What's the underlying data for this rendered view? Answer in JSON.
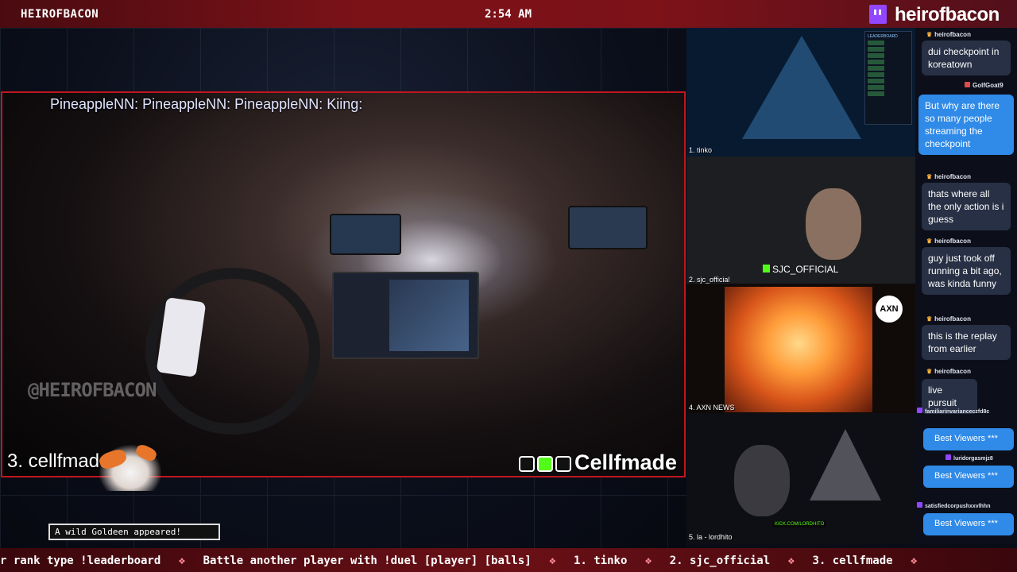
{
  "top_bar": {
    "channel_label": "HEIROFBACON",
    "clock": "2:54 AM",
    "platform_icon": "twitch-icon",
    "streamer_name": "heirofbacon"
  },
  "main_cam": {
    "overlay_ticker": "PineappleNN:  PineappleNN:  PineappleNN:  Kiing:",
    "watermark": "@HEIROFBACON",
    "rank_label": "3. cellfmade",
    "social_handle": "Cellfmade",
    "social_icons": [
      "instagram-icon",
      "kick-icon",
      "x-icon"
    ]
  },
  "pokemon_toast": "A wild Goldeen appeared!",
  "side_panels": [
    {
      "label": "1. tinko"
    },
    {
      "label": "2. sjc_official",
      "overlay": "SJC_OFFICIAL"
    },
    {
      "label": "4. AXN NEWS",
      "logo": "AXN"
    },
    {
      "label": "5. la - lordhito",
      "overlay": "KICK.COM/LORDHITO"
    }
  ],
  "leaderboard": {
    "title": "LEADERBOARD"
  },
  "chat": [
    {
      "user": "heirofbacon",
      "text": "dui checkpoint in koreatown",
      "style": "dark"
    },
    {
      "user": "GolfGoat9",
      "text": "But why are there so many people streaming the checkpoint",
      "style": "blue"
    },
    {
      "user": "heirofbacon",
      "text": "thats where all the only action is i guess",
      "style": "dark"
    },
    {
      "user": "heirofbacon",
      "text": "guy just took off running a bit ago, was kinda funny",
      "style": "dark"
    },
    {
      "user": "heirofbacon",
      "text": "this is the replay from earlier",
      "style": "dark"
    },
    {
      "user": "heirofbacon",
      "text": "live pursuit",
      "style": "dark"
    },
    {
      "user": "familiarinvarianceczfd8c",
      "text": "Best Viewers ***",
      "style": "blue"
    },
    {
      "user": "luridorgasmjz8",
      "text": "Best Viewers ***",
      "style": "blue"
    },
    {
      "user": "satisfiedcorpushxxvlhhn",
      "text": "Best Viewers ***",
      "style": "blue"
    }
  ],
  "bottom_ticker": {
    "segments": [
      "r rank type !leaderboard",
      "Battle another player with !duel [player] [balls]",
      "1. tinko",
      "2. sjc_official",
      "3. cellfmade"
    ],
    "separator_icon": "candy-icon"
  },
  "colors": {
    "accent_red": "#c0161e",
    "twitch_purple": "#9146ff",
    "kick_green": "#53fc18",
    "chat_blue": "#2f8ae8"
  }
}
